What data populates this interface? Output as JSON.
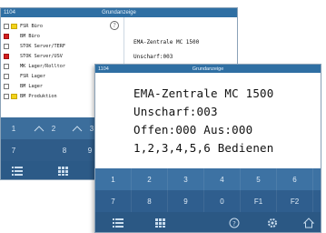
{
  "back_window": {
    "title_left": "1104",
    "title_center": "Grundanzeige",
    "zones": [
      {
        "label": "FSR  Büro",
        "checkbox": "white",
        "marker": "yellow"
      },
      {
        "label": "BM Büro",
        "checkbox": "red",
        "marker": "none"
      },
      {
        "label": "STOK Server/TERF",
        "checkbox": "white",
        "marker": "none"
      },
      {
        "label": "STOK Server/USV",
        "checkbox": "red",
        "marker": "none"
      },
      {
        "label": "MK Lager/Rolltor",
        "checkbox": "white",
        "marker": "none"
      },
      {
        "label": "FSR Lager",
        "checkbox": "white",
        "marker": "none"
      },
      {
        "label": "BM Lager",
        "checkbox": "white",
        "marker": "none"
      },
      {
        "label": "BM Produktion",
        "checkbox": "white",
        "marker": "yellow"
      }
    ],
    "info_icon": "?",
    "display_line1": "EMA-Zentrale MC 1500",
    "display_line2": "Unscharf:003",
    "keypad_row1": [
      "1",
      "2",
      "3"
    ],
    "keypad_row2": [
      "7",
      "8",
      "9"
    ]
  },
  "front_window": {
    "title_left": "1104",
    "title_center": "Grundanzeige",
    "display": {
      "line1": "EMA-Zentrale MC 1500",
      "line2": "Unscharf:003",
      "line3": "Offen:000   Aus:000",
      "line4": "1,2,3,4,5,6 Bedienen"
    },
    "keypad_row1": [
      "1",
      "2",
      "3",
      "4",
      "5",
      "6"
    ],
    "keypad_row2": [
      "7",
      "8",
      "9",
      "0",
      "F1",
      "F2"
    ],
    "bottom_icons": [
      "list-icon",
      "grid-icon",
      "help-icon",
      "settings-icon",
      "home-icon"
    ]
  },
  "colors": {
    "titlebar": "#2f6fa3",
    "keypad_light": "#3d72a3",
    "keypad_dark": "#2f5e8e",
    "alarm_red": "#d42020",
    "marker_yellow": "#f2d21a"
  }
}
